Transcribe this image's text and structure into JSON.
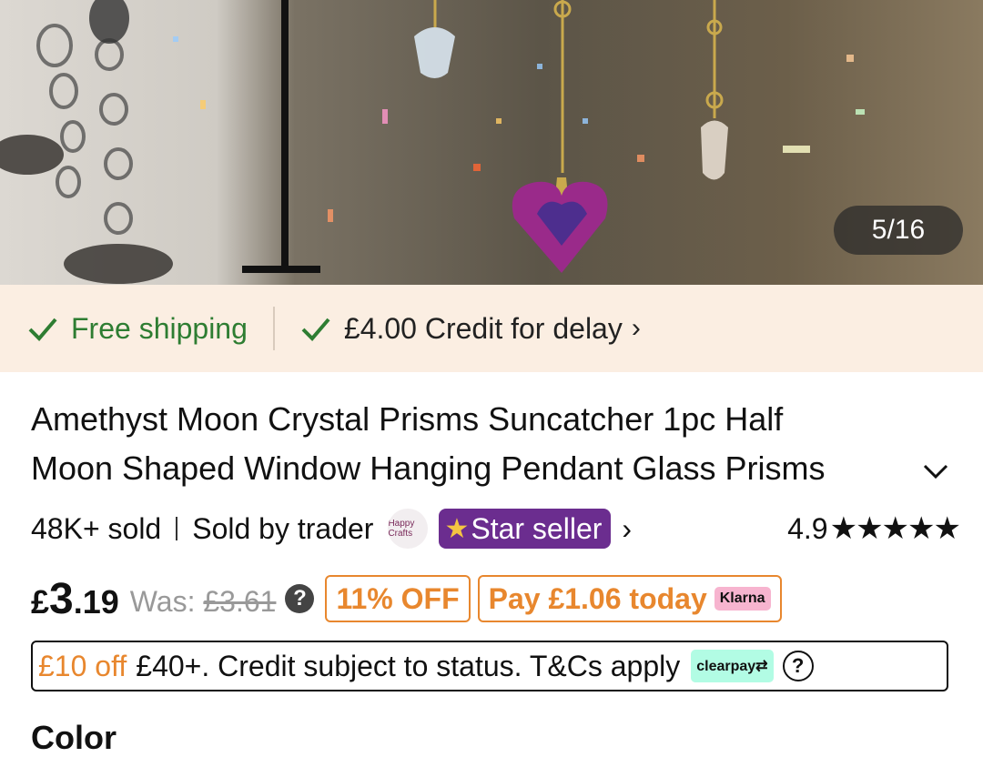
{
  "gallery": {
    "counter": "5/16"
  },
  "shipping": {
    "free_label": "Free shipping",
    "credit_label": "£4.00 Credit for delay",
    "accent": "#2e7d32",
    "bg": "#fbeee2"
  },
  "product": {
    "title_line1": "Amethyst Moon Crystal Prisms Suncatcher 1pc Half",
    "title_line2": "Moon Shaped Window Hanging Pendant Glass Prisms"
  },
  "seller": {
    "sold": "48K+ sold",
    "sold_by": "Sold by trader",
    "avatar_text": "Happy Crafts",
    "badge_label": "Star seller",
    "badge_color": "#6b2d8f"
  },
  "rating": {
    "score": "4.9",
    "stars": "★★★★★",
    "value": 4.9
  },
  "price": {
    "currency": "£",
    "integer": "3",
    "decimal": ".19",
    "was_label": "Was:",
    "was_value": "£3.61",
    "discount": "11% OFF",
    "klarna_text": "Pay £1.06 today",
    "klarna_logo": "Klarna",
    "accent": "#e8872e"
  },
  "clearpay": {
    "offer": "£10 off",
    "text": "£40+. Credit subject to status. T&Cs apply",
    "logo": "clearpay⇄",
    "help": "?"
  },
  "next_section": {
    "label": "Color"
  }
}
